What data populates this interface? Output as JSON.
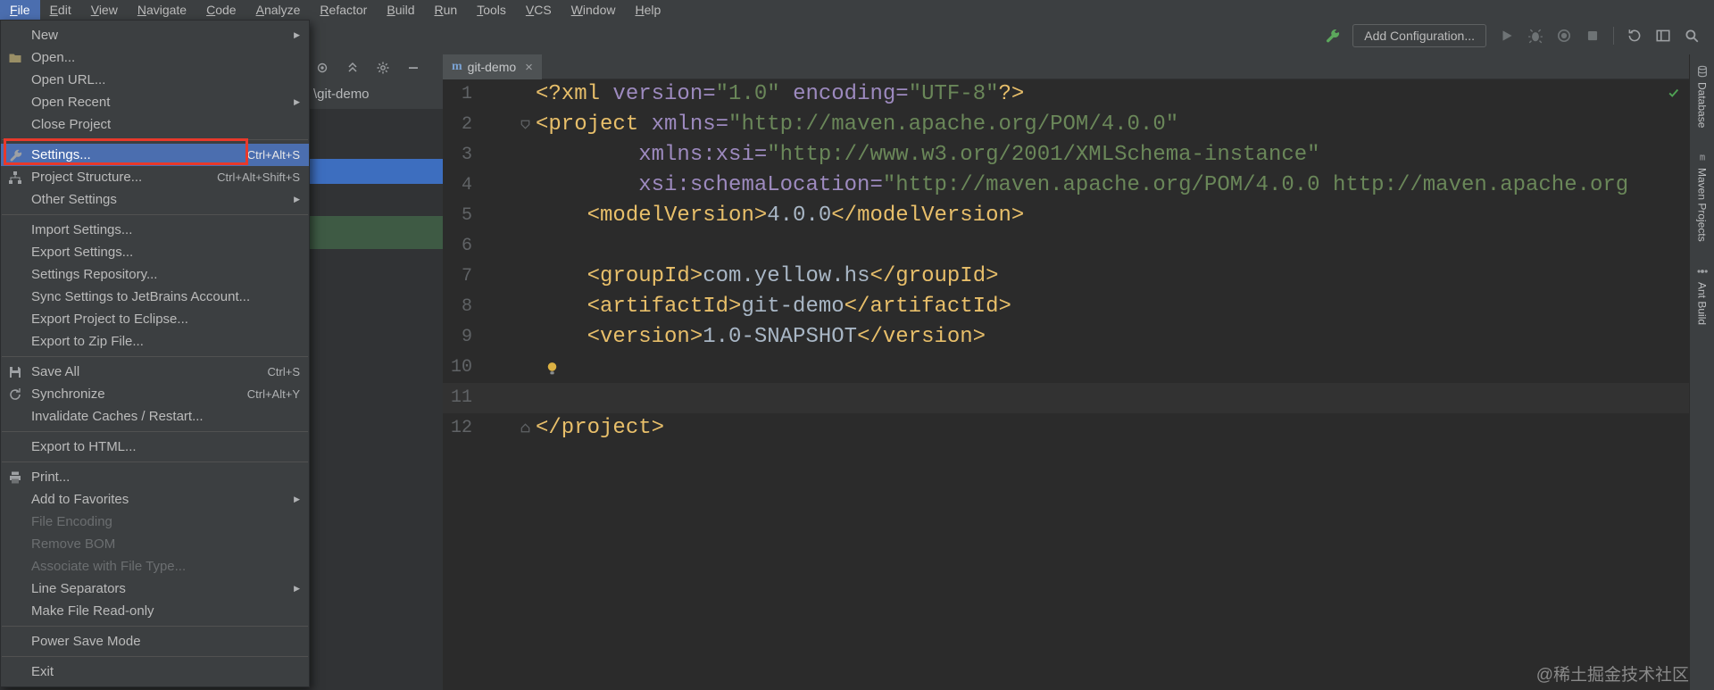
{
  "colors": {
    "panel_bg": "#3c3f41",
    "editor_bg": "#2b2b2b",
    "menu_selection": "#4b6eaf",
    "annotation_red": "#e8392b",
    "tag": "#e8bf6a",
    "attribute": "#9d8abf",
    "string_value": "#6a8759",
    "plain_text": "#a9b7c6",
    "line_number": "#606366",
    "caret_line": "#323232",
    "selected_row": "#3d6ebf",
    "vcs_row": "#3e5a44",
    "menu_text": "#bbbbbb",
    "disabled_text": "#6b6e70"
  },
  "menubar": {
    "items": [
      "File",
      "Edit",
      "View",
      "Navigate",
      "Code",
      "Analyze",
      "Refactor",
      "Build",
      "Run",
      "Tools",
      "VCS",
      "Window",
      "Help"
    ],
    "active": "File"
  },
  "file_menu": {
    "items": [
      {
        "label": "New",
        "submenu": true
      },
      {
        "label": "Open...",
        "icon": "folder-icon"
      },
      {
        "label": "Open URL..."
      },
      {
        "label": "Open Recent",
        "submenu": true
      },
      {
        "label": "Close Project"
      },
      {
        "type": "separator"
      },
      {
        "label": "Settings...",
        "shortcut": "Ctrl+Alt+S",
        "icon": "wrench-icon",
        "selected": true
      },
      {
        "label": "Project Structure...",
        "shortcut": "Ctrl+Alt+Shift+S",
        "icon": "structure-icon"
      },
      {
        "label": "Other Settings",
        "submenu": true
      },
      {
        "type": "separator"
      },
      {
        "label": "Import Settings..."
      },
      {
        "label": "Export Settings..."
      },
      {
        "label": "Settings Repository..."
      },
      {
        "label": "Sync Settings to JetBrains Account..."
      },
      {
        "label": "Export Project to Eclipse..."
      },
      {
        "label": "Export to Zip File..."
      },
      {
        "type": "separator"
      },
      {
        "label": "Save All",
        "shortcut": "Ctrl+S",
        "icon": "save-icon"
      },
      {
        "label": "Synchronize",
        "shortcut": "Ctrl+Alt+Y",
        "icon": "sync-icon"
      },
      {
        "label": "Invalidate Caches / Restart..."
      },
      {
        "type": "separator"
      },
      {
        "label": "Export to HTML..."
      },
      {
        "type": "separator"
      },
      {
        "label": "Print...",
        "icon": "printer-icon"
      },
      {
        "label": "Add to Favorites",
        "submenu": true
      },
      {
        "label": "File Encoding",
        "disabled": true
      },
      {
        "label": "Remove BOM",
        "disabled": true
      },
      {
        "label": "Associate with File Type...",
        "disabled": true
      },
      {
        "label": "Line Separators",
        "submenu": true
      },
      {
        "label": "Make File Read-only"
      },
      {
        "type": "separator"
      },
      {
        "label": "Power Save Mode"
      },
      {
        "type": "separator"
      },
      {
        "label": "Exit"
      }
    ]
  },
  "toolbar": {
    "build_tool_icon": "wrench-green-icon",
    "add_configuration_label": "Add Configuration...",
    "run_icons": [
      "run-icon",
      "debug-icon",
      "coverage-icon",
      "stop-icon"
    ],
    "right_icons": [
      "restore-layout-icon",
      "layout-icon",
      "search-icon"
    ]
  },
  "project_panel": {
    "path_tail": "\\git-demo",
    "toolbar_icons": [
      "locate-icon",
      "collapse-all-icon",
      "settings-gear-icon",
      "hide-icon"
    ]
  },
  "editor": {
    "tab": {
      "icon_letter": "m",
      "label": "git-demo",
      "close": "×"
    },
    "inspection_icon": "check-icon",
    "lines": [
      {
        "num": 1,
        "tokens": [
          [
            "tag",
            "<?xml "
          ],
          [
            "attr",
            "version="
          ],
          [
            "val",
            "\"1.0\""
          ],
          [
            "plain",
            " "
          ],
          [
            "attr",
            "encoding="
          ],
          [
            "val",
            "\"UTF-8\""
          ],
          [
            "tag",
            "?>"
          ]
        ]
      },
      {
        "num": 2,
        "fold": "down",
        "tokens": [
          [
            "tag",
            "<project "
          ],
          [
            "attr",
            "xmlns="
          ],
          [
            "val",
            "\"http://maven.apache.org/POM/4.0.0\""
          ]
        ]
      },
      {
        "num": 3,
        "tokens": [
          [
            "plain",
            "        "
          ],
          [
            "attr",
            "xmlns:xsi="
          ],
          [
            "val",
            "\"http://www.w3.org/2001/XMLSchema-instance\""
          ]
        ]
      },
      {
        "num": 4,
        "tokens": [
          [
            "plain",
            "        "
          ],
          [
            "attr",
            "xsi:schemaLocation="
          ],
          [
            "val",
            "\"http://maven.apache.org/POM/4.0.0 http://maven.apache.org"
          ]
        ]
      },
      {
        "num": 5,
        "tokens": [
          [
            "plain",
            "    "
          ],
          [
            "tag",
            "<modelVersion>"
          ],
          [
            "plain",
            "4.0.0"
          ],
          [
            "tag",
            "</modelVersion>"
          ]
        ]
      },
      {
        "num": 6,
        "tokens": []
      },
      {
        "num": 7,
        "tokens": [
          [
            "plain",
            "    "
          ],
          [
            "tag",
            "<groupId>"
          ],
          [
            "plain",
            "com.yellow.hs"
          ],
          [
            "tag",
            "</groupId>"
          ]
        ]
      },
      {
        "num": 8,
        "tokens": [
          [
            "plain",
            "    "
          ],
          [
            "tag",
            "<artifactId>"
          ],
          [
            "plain",
            "git-demo"
          ],
          [
            "tag",
            "</artifactId>"
          ]
        ]
      },
      {
        "num": 9,
        "tokens": [
          [
            "plain",
            "    "
          ],
          [
            "tag",
            "<version>"
          ],
          [
            "plain",
            "1.0-SNAPSHOT"
          ],
          [
            "tag",
            "</version>"
          ]
        ]
      },
      {
        "num": 10,
        "bulb": true,
        "tokens": []
      },
      {
        "num": 11,
        "caret": true,
        "tokens": []
      },
      {
        "num": 12,
        "fold": "up",
        "tokens": [
          [
            "tag",
            "</project>"
          ]
        ]
      }
    ]
  },
  "right_sidebar": {
    "buttons": [
      {
        "label": "Database",
        "icon": "database-icon"
      },
      {
        "label": "Maven Projects",
        "icon": "maven-m-icon"
      },
      {
        "label": "Ant Build",
        "icon": "ant-icon"
      }
    ]
  },
  "statusbar": {
    "icon": "toolwindows-icon"
  },
  "watermark": {
    "text": "@稀土掘金技术社区"
  }
}
